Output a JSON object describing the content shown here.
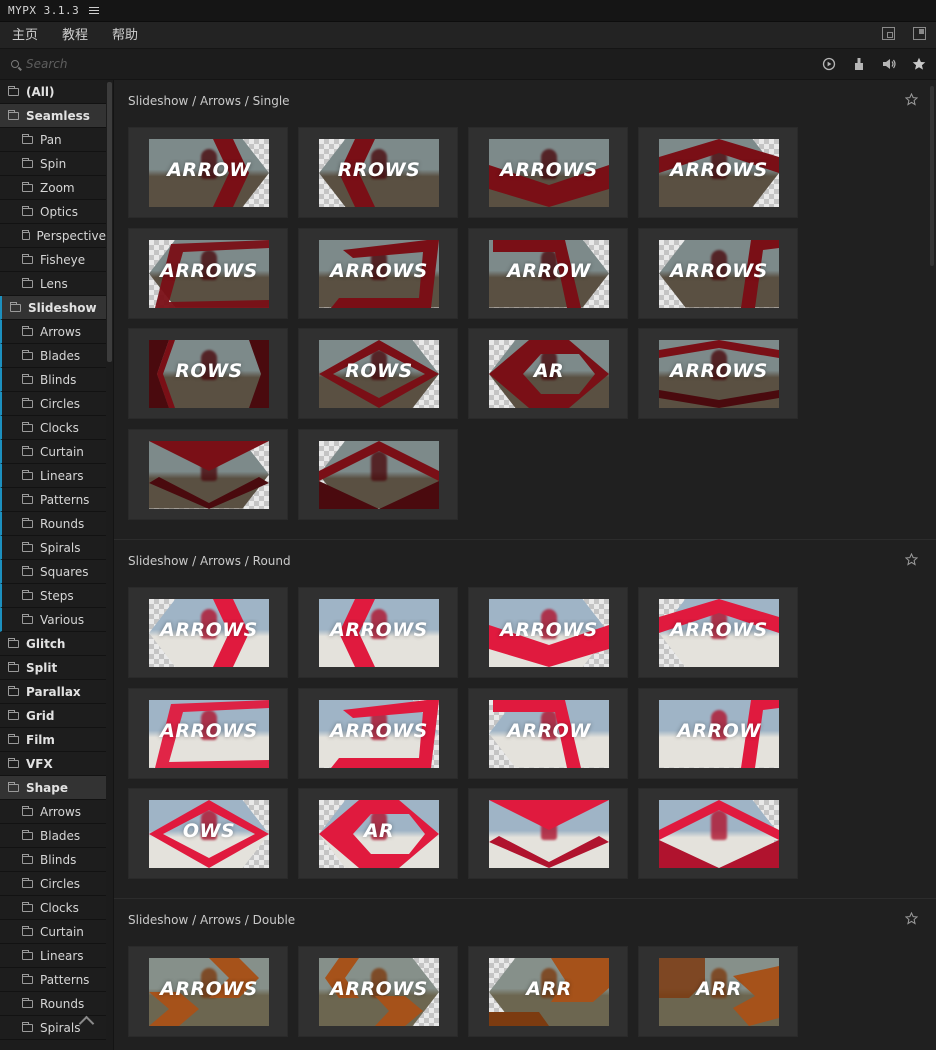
{
  "app": {
    "title": "MYPX 3.1.3"
  },
  "nav": {
    "items": [
      "主页",
      "教程",
      "帮助"
    ]
  },
  "search": {
    "placeholder": "Search"
  },
  "toolbar": {
    "icons": [
      "play-icon",
      "brush-icon",
      "volume-icon",
      "star-icon"
    ]
  },
  "sidebar": {
    "items": [
      {
        "label": "(All)",
        "kind": "cat"
      },
      {
        "label": "Seamless",
        "kind": "cat-open"
      },
      {
        "label": "Pan",
        "kind": "sub"
      },
      {
        "label": "Spin",
        "kind": "sub"
      },
      {
        "label": "Zoom",
        "kind": "sub"
      },
      {
        "label": "Optics",
        "kind": "sub"
      },
      {
        "label": "Perspective",
        "kind": "sub"
      },
      {
        "label": "Fisheye",
        "kind": "sub"
      },
      {
        "label": "Lens",
        "kind": "sub"
      },
      {
        "label": "Slideshow",
        "kind": "cat-open-active"
      },
      {
        "label": "Arrows",
        "kind": "sub-active"
      },
      {
        "label": "Blades",
        "kind": "sub-active"
      },
      {
        "label": "Blinds",
        "kind": "sub-active"
      },
      {
        "label": "Circles",
        "kind": "sub-active"
      },
      {
        "label": "Clocks",
        "kind": "sub-active"
      },
      {
        "label": "Curtain",
        "kind": "sub-active"
      },
      {
        "label": "Linears",
        "kind": "sub-active"
      },
      {
        "label": "Patterns",
        "kind": "sub-active"
      },
      {
        "label": "Rounds",
        "kind": "sub-active"
      },
      {
        "label": "Spirals",
        "kind": "sub-active"
      },
      {
        "label": "Squares",
        "kind": "sub-active"
      },
      {
        "label": "Steps",
        "kind": "sub-active"
      },
      {
        "label": "Various",
        "kind": "sub-active"
      },
      {
        "label": "Glitch",
        "kind": "cat"
      },
      {
        "label": "Split",
        "kind": "cat"
      },
      {
        "label": "Parallax",
        "kind": "cat"
      },
      {
        "label": "Grid",
        "kind": "cat"
      },
      {
        "label": "Film",
        "kind": "cat"
      },
      {
        "label": "VFX",
        "kind": "cat"
      },
      {
        "label": "Shape",
        "kind": "cat-open"
      },
      {
        "label": "Arrows",
        "kind": "sub"
      },
      {
        "label": "Blades",
        "kind": "sub"
      },
      {
        "label": "Blinds",
        "kind": "sub"
      },
      {
        "label": "Circles",
        "kind": "sub"
      },
      {
        "label": "Clocks",
        "kind": "sub"
      },
      {
        "label": "Curtain",
        "kind": "sub"
      },
      {
        "label": "Linears",
        "kind": "sub"
      },
      {
        "label": "Patterns",
        "kind": "sub"
      },
      {
        "label": "Rounds",
        "kind": "sub"
      },
      {
        "label": "Spirals",
        "kind": "sub"
      }
    ]
  },
  "sections": [
    {
      "title": "Slideshow / Arrows / Single",
      "theme": "dark-red",
      "thumbs": [
        {
          "word": "ARROW",
          "shape": "arrow-right"
        },
        {
          "word": "RROWS",
          "shape": "arrow-left"
        },
        {
          "word": "ARROWS",
          "shape": "chevron-down"
        },
        {
          "word": "ARROWS",
          "shape": "chevron-up"
        },
        {
          "word": "ARROWS",
          "shape": "frame-left"
        },
        {
          "word": "ARROWS",
          "shape": "frame-right"
        },
        {
          "word": "ARROW",
          "shape": "frame-mid"
        },
        {
          "word": "ARROWS",
          "shape": "frame-edge"
        },
        {
          "word": "ROWS",
          "shape": "hex"
        },
        {
          "word": "ROWS",
          "shape": "diamond"
        },
        {
          "word": "AR",
          "shape": "diamond-small"
        },
        {
          "word": "ARROWS",
          "shape": "bands"
        },
        {
          "word": "",
          "shape": "vee"
        },
        {
          "word": "",
          "shape": "vee-split"
        }
      ]
    },
    {
      "title": "Slideshow / Arrows / Round",
      "theme": "pink",
      "thumbs": [
        {
          "word": "ARROWS",
          "shape": "arrow-right"
        },
        {
          "word": "ARROWS",
          "shape": "arrow-left"
        },
        {
          "word": "ARROWS",
          "shape": "chevron-down"
        },
        {
          "word": "ARROWS",
          "shape": "chevron-up"
        },
        {
          "word": "ARROWS",
          "shape": "frame-left"
        },
        {
          "word": "ARROWS",
          "shape": "frame-right"
        },
        {
          "word": "ARROW",
          "shape": "frame-mid"
        },
        {
          "word": "ARROW",
          "shape": "frame-edge"
        },
        {
          "word": "OWS",
          "shape": "diamond"
        },
        {
          "word": "AR",
          "shape": "diamond-small"
        },
        {
          "word": "",
          "shape": "vee"
        },
        {
          "word": "",
          "shape": "vee-split"
        }
      ]
    },
    {
      "title": "Slideshow / Arrows / Double",
      "theme": "orange",
      "thumbs": [
        {
          "word": "ARROWS",
          "shape": "double-right"
        },
        {
          "word": "ARROWS",
          "shape": "double-left"
        },
        {
          "word": "ARR",
          "shape": "double-hex"
        },
        {
          "word": "ARR",
          "shape": "double-frame"
        }
      ]
    }
  ],
  "themes": {
    "dark-red": {
      "accent": "#7a0f16",
      "accent2": "#4a0a0e",
      "sky": "#7d8a8a",
      "ground": "#5a5042"
    },
    "pink": {
      "accent": "#e01a3e",
      "accent2": "#b0132e",
      "sky": "#9fb4c6",
      "ground": "#e4e2dc"
    },
    "orange": {
      "accent": "#a6521a",
      "accent2": "#7c3b10",
      "sky": "#86908a",
      "ground": "#6c6650"
    }
  }
}
